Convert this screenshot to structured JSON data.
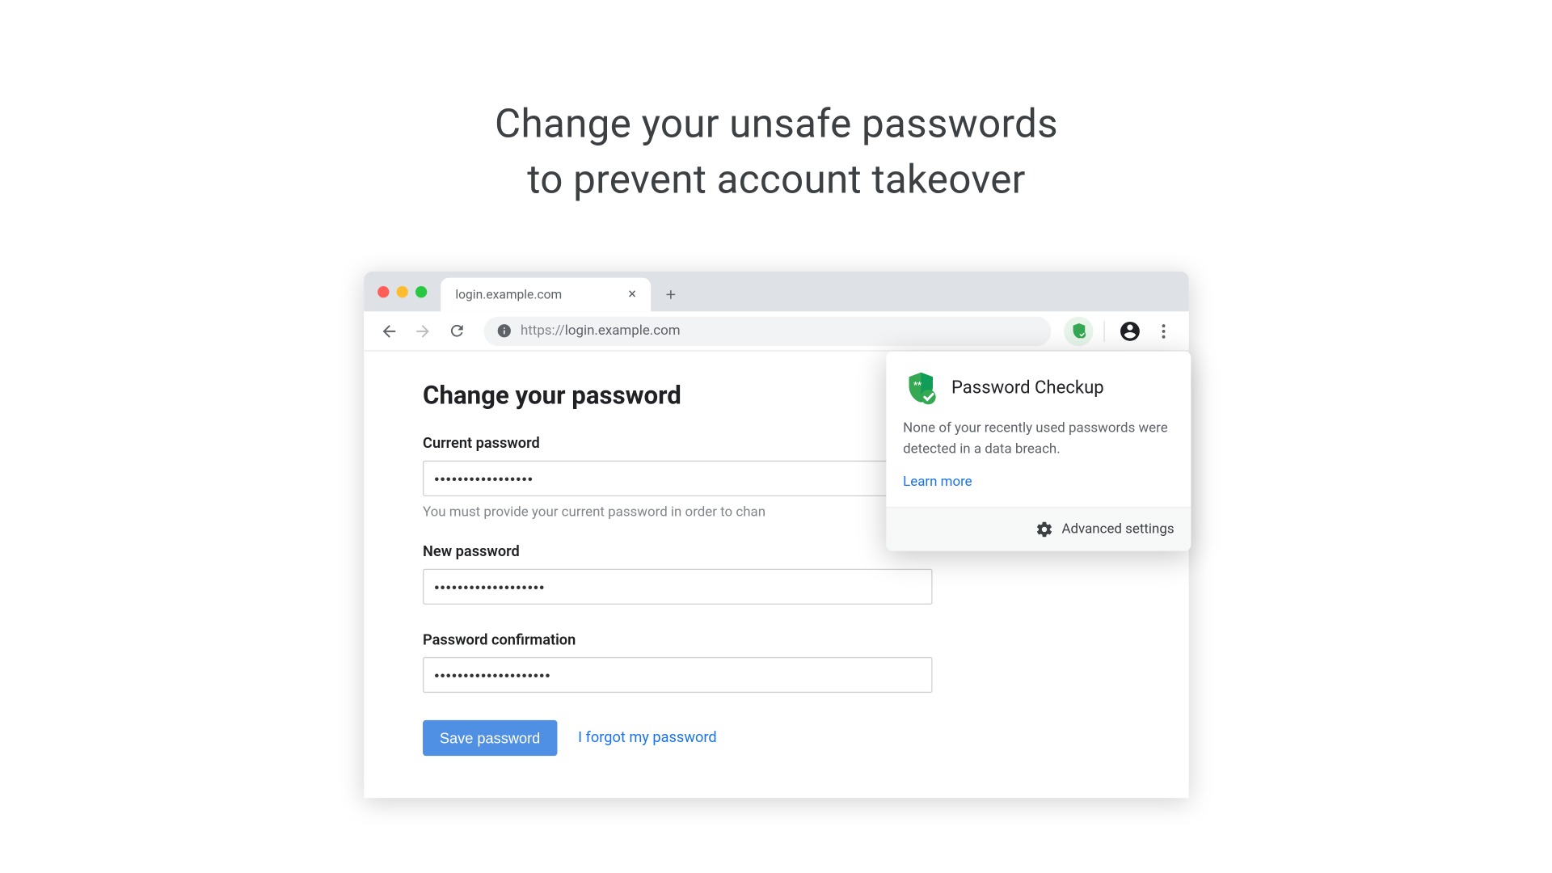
{
  "headline": {
    "line1": "Change your unsafe passwords",
    "line2": "to prevent account takeover"
  },
  "browser": {
    "tab_title": "login.example.com",
    "url": "https://login.example.com",
    "url_prefix": "https://",
    "url_host": "login.example.com"
  },
  "page": {
    "title": "Change your password",
    "current_password": {
      "label": "Current password",
      "value": "•••••••••••••••••",
      "help": "You must provide your current password in order to chan"
    },
    "new_password": {
      "label": "New password",
      "value": "•••••••••••••••••••"
    },
    "confirm_password": {
      "label": "Password confirmation",
      "value": "••••••••••••••••••••"
    },
    "save_button": "Save password",
    "forgot_link": "I forgot my password"
  },
  "popup": {
    "title": "Password Checkup",
    "message": "None of your recently used passwords were detected in a data breach.",
    "learn_more": "Learn more",
    "advanced": "Advanced settings"
  }
}
